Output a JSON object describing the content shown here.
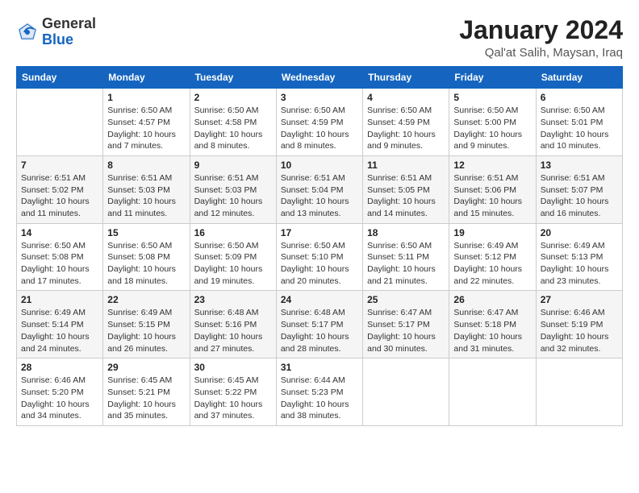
{
  "logo": {
    "general": "General",
    "blue": "Blue"
  },
  "header": {
    "month_title": "January 2024",
    "location": "Qal'at Salih, Maysan, Iraq"
  },
  "weekdays": [
    "Sunday",
    "Monday",
    "Tuesday",
    "Wednesday",
    "Thursday",
    "Friday",
    "Saturday"
  ],
  "weeks": [
    [
      {
        "day": "",
        "info": ""
      },
      {
        "day": "1",
        "info": "Sunrise: 6:50 AM\nSunset: 4:57 PM\nDaylight: 10 hours\nand 7 minutes."
      },
      {
        "day": "2",
        "info": "Sunrise: 6:50 AM\nSunset: 4:58 PM\nDaylight: 10 hours\nand 8 minutes."
      },
      {
        "day": "3",
        "info": "Sunrise: 6:50 AM\nSunset: 4:59 PM\nDaylight: 10 hours\nand 8 minutes."
      },
      {
        "day": "4",
        "info": "Sunrise: 6:50 AM\nSunset: 4:59 PM\nDaylight: 10 hours\nand 9 minutes."
      },
      {
        "day": "5",
        "info": "Sunrise: 6:50 AM\nSunset: 5:00 PM\nDaylight: 10 hours\nand 9 minutes."
      },
      {
        "day": "6",
        "info": "Sunrise: 6:50 AM\nSunset: 5:01 PM\nDaylight: 10 hours\nand 10 minutes."
      }
    ],
    [
      {
        "day": "7",
        "info": "Sunrise: 6:51 AM\nSunset: 5:02 PM\nDaylight: 10 hours\nand 11 minutes."
      },
      {
        "day": "8",
        "info": "Sunrise: 6:51 AM\nSunset: 5:03 PM\nDaylight: 10 hours\nand 11 minutes."
      },
      {
        "day": "9",
        "info": "Sunrise: 6:51 AM\nSunset: 5:03 PM\nDaylight: 10 hours\nand 12 minutes."
      },
      {
        "day": "10",
        "info": "Sunrise: 6:51 AM\nSunset: 5:04 PM\nDaylight: 10 hours\nand 13 minutes."
      },
      {
        "day": "11",
        "info": "Sunrise: 6:51 AM\nSunset: 5:05 PM\nDaylight: 10 hours\nand 14 minutes."
      },
      {
        "day": "12",
        "info": "Sunrise: 6:51 AM\nSunset: 5:06 PM\nDaylight: 10 hours\nand 15 minutes."
      },
      {
        "day": "13",
        "info": "Sunrise: 6:51 AM\nSunset: 5:07 PM\nDaylight: 10 hours\nand 16 minutes."
      }
    ],
    [
      {
        "day": "14",
        "info": "Sunrise: 6:50 AM\nSunset: 5:08 PM\nDaylight: 10 hours\nand 17 minutes."
      },
      {
        "day": "15",
        "info": "Sunrise: 6:50 AM\nSunset: 5:08 PM\nDaylight: 10 hours\nand 18 minutes."
      },
      {
        "day": "16",
        "info": "Sunrise: 6:50 AM\nSunset: 5:09 PM\nDaylight: 10 hours\nand 19 minutes."
      },
      {
        "day": "17",
        "info": "Sunrise: 6:50 AM\nSunset: 5:10 PM\nDaylight: 10 hours\nand 20 minutes."
      },
      {
        "day": "18",
        "info": "Sunrise: 6:50 AM\nSunset: 5:11 PM\nDaylight: 10 hours\nand 21 minutes."
      },
      {
        "day": "19",
        "info": "Sunrise: 6:49 AM\nSunset: 5:12 PM\nDaylight: 10 hours\nand 22 minutes."
      },
      {
        "day": "20",
        "info": "Sunrise: 6:49 AM\nSunset: 5:13 PM\nDaylight: 10 hours\nand 23 minutes."
      }
    ],
    [
      {
        "day": "21",
        "info": "Sunrise: 6:49 AM\nSunset: 5:14 PM\nDaylight: 10 hours\nand 24 minutes."
      },
      {
        "day": "22",
        "info": "Sunrise: 6:49 AM\nSunset: 5:15 PM\nDaylight: 10 hours\nand 26 minutes."
      },
      {
        "day": "23",
        "info": "Sunrise: 6:48 AM\nSunset: 5:16 PM\nDaylight: 10 hours\nand 27 minutes."
      },
      {
        "day": "24",
        "info": "Sunrise: 6:48 AM\nSunset: 5:17 PM\nDaylight: 10 hours\nand 28 minutes."
      },
      {
        "day": "25",
        "info": "Sunrise: 6:47 AM\nSunset: 5:17 PM\nDaylight: 10 hours\nand 30 minutes."
      },
      {
        "day": "26",
        "info": "Sunrise: 6:47 AM\nSunset: 5:18 PM\nDaylight: 10 hours\nand 31 minutes."
      },
      {
        "day": "27",
        "info": "Sunrise: 6:46 AM\nSunset: 5:19 PM\nDaylight: 10 hours\nand 32 minutes."
      }
    ],
    [
      {
        "day": "28",
        "info": "Sunrise: 6:46 AM\nSunset: 5:20 PM\nDaylight: 10 hours\nand 34 minutes."
      },
      {
        "day": "29",
        "info": "Sunrise: 6:45 AM\nSunset: 5:21 PM\nDaylight: 10 hours\nand 35 minutes."
      },
      {
        "day": "30",
        "info": "Sunrise: 6:45 AM\nSunset: 5:22 PM\nDaylight: 10 hours\nand 37 minutes."
      },
      {
        "day": "31",
        "info": "Sunrise: 6:44 AM\nSunset: 5:23 PM\nDaylight: 10 hours\nand 38 minutes."
      },
      {
        "day": "",
        "info": ""
      },
      {
        "day": "",
        "info": ""
      },
      {
        "day": "",
        "info": ""
      }
    ]
  ]
}
